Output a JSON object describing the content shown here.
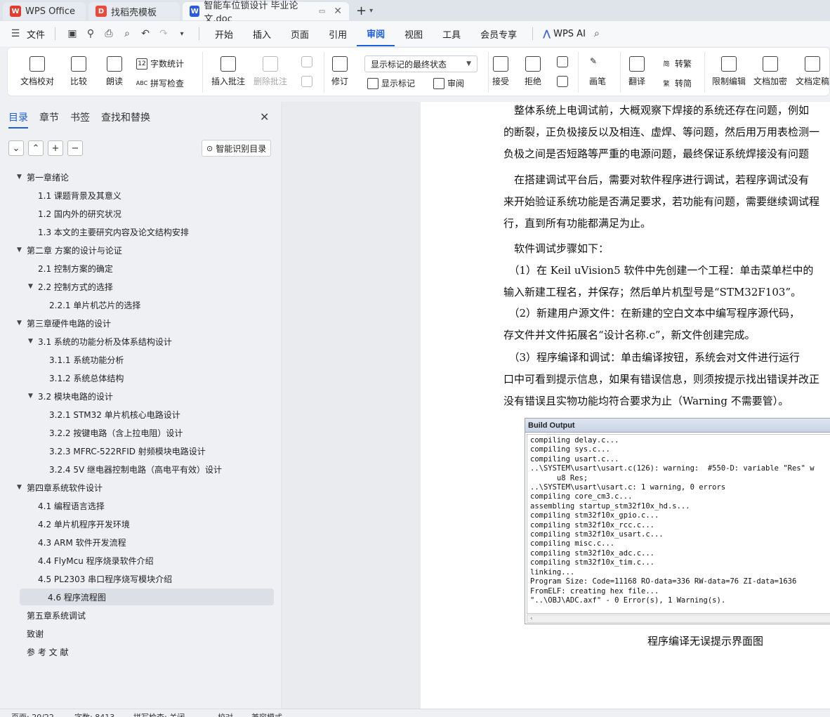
{
  "tabs": [
    {
      "label": "WPS Office",
      "logo": "W",
      "color": "#e33b2e"
    },
    {
      "label": "找稻壳模板",
      "logo": "D",
      "color": "#e84a3c"
    },
    {
      "label": "智能车位锁设计 毕业论文.doc",
      "logo": "W",
      "color": "#2b5bd7"
    }
  ],
  "menubar": {
    "file": "文件",
    "items": [
      "开始",
      "插入",
      "页面",
      "引用",
      "审阅",
      "视图",
      "工具",
      "会员专享"
    ],
    "active": "审阅",
    "wps_ai": "WPS AI"
  },
  "ribbon": {
    "doc_check": "文档校对",
    "compare": "比较",
    "read_aloud": "朗读",
    "word_count": "字数统计",
    "spell_check": "拼写检查",
    "insert_comment": "插入批注",
    "delete_comment": "删除批注",
    "revise": "修订",
    "markup_state": "显示标记的最终状态",
    "show_markup": "显示标记",
    "review": "审阅",
    "accept": "接受",
    "reject": "拒绝",
    "ink": "画笔",
    "translate": "翻译",
    "to_traditional": "转繁",
    "to_simplified": "转简",
    "restrict_edit": "限制编辑",
    "encrypt": "文档加密",
    "finalize": "文档定稿"
  },
  "panel": {
    "tabs": [
      "目录",
      "章节",
      "书签",
      "查找和替换"
    ],
    "smart_toc": "智能识别目录",
    "toc": [
      {
        "label": "第一章绪论",
        "level": 0,
        "arrow": true
      },
      {
        "label": "1.1 课题背景及其意义",
        "level": 1,
        "arrow": false
      },
      {
        "label": "1.2 国内外的研究状况",
        "level": 1,
        "arrow": false
      },
      {
        "label": "1.3 本文的主要研究内容及论文结构安排",
        "level": 1,
        "arrow": false
      },
      {
        "label": "第二章 方案的设计与论证",
        "level": 0,
        "arrow": true
      },
      {
        "label": "2.1 控制方案的确定",
        "level": 1,
        "arrow": false
      },
      {
        "label": "2.2 控制方式的选择",
        "level": 1,
        "arrow": true
      },
      {
        "label": "2.2.1 单片机芯片的选择",
        "level": 2,
        "arrow": false
      },
      {
        "label": "第三章硬件电路的设计",
        "level": 0,
        "arrow": true
      },
      {
        "label": "3.1 系统的功能分析及体系结构设计",
        "level": 1,
        "arrow": true
      },
      {
        "label": "3.1.1 系统功能分析",
        "level": 2,
        "arrow": false
      },
      {
        "label": "3.1.2 系统总体结构",
        "level": 2,
        "arrow": false
      },
      {
        "label": "3.2 模块电路的设计",
        "level": 1,
        "arrow": true
      },
      {
        "label": "3.2.1 STM32 单片机核心电路设计",
        "level": 2,
        "arrow": false
      },
      {
        "label": "3.2.2 按键电路（含上拉电阻）设计",
        "level": 2,
        "arrow": false
      },
      {
        "label": "3.2.3 MFRC-522RFID 射频模块电路设计",
        "level": 2,
        "arrow": false
      },
      {
        "label": "3.2.4 5V 继电器控制电路（高电平有效）设计",
        "level": 2,
        "arrow": false
      },
      {
        "label": "第四章系统软件设计",
        "level": 0,
        "arrow": true
      },
      {
        "label": "4.1 编程语言选择",
        "level": 1,
        "arrow": false
      },
      {
        "label": "4.2 单片机程序开发环境",
        "level": 1,
        "arrow": false
      },
      {
        "label": "4.3 ARM 软件开发流程",
        "level": 1,
        "arrow": false
      },
      {
        "label": "4.4 FlyMcu 程序烧录软件介绍",
        "level": 1,
        "arrow": false
      },
      {
        "label": "4.5 PL2303 串口程序烧写模块介绍",
        "level": 1,
        "arrow": false
      },
      {
        "label": "4.6 程序流程图",
        "level": 1,
        "arrow": false,
        "selected": true
      },
      {
        "label": "第五章系统调试",
        "level": 0,
        "arrow": false
      },
      {
        "label": "致谢",
        "level": 0,
        "arrow": false
      },
      {
        "label": "参 考 文 献",
        "level": 0,
        "arrow": false
      }
    ]
  },
  "document": {
    "lines": [
      "　整体系统上电调试前，大概观察下焊接的系统还存在问题，例如",
      "的断裂，正负极接反以及相连、虚焊、等问题，然后用万用表检测一",
      "负极之间是否短路等严重的电源问题，最终保证系统焊接没有问题",
      "　在搭建调试平台后，需要对软件程序进行调试，若程序调试没有",
      "来开始验证系统功能是否满足要求，若功能有问题，需要继续调试程",
      "行，直到所有功能都满足为止。",
      "　软件调试步骤如下：",
      "　（1）在 Keil uVision5 软件中先创建一个工程：单击菜单栏中的",
      "输入新建工程名，并保存；然后单片机型号是“STM32F103”。",
      "　（2）新建用户源文件：在新建的空白文本中编写程序源代码，",
      "存文件并文件拓展名“设计名称.c”，新文件创建完成。",
      "　（3）程序编译和调试：单击编译按钮，系统会对文件进行运行",
      "口中可看到提示信息，如果有错误信息，则须按提示找出错误并改正",
      "没有错误且实物功能均符合要求为止（Warning 不需要管）。"
    ],
    "build_title": "Build Output",
    "build_lines": [
      "compiling delay.c...",
      "compiling sys.c...",
      "compiling usart.c...",
      "..\\SYSTEM\\usart\\usart.c(126): warning:  #550-D: variable \"Res\" w",
      "      u8 Res;",
      "..\\SYSTEM\\usart\\usart.c: 1 warning, 0 errors",
      "compiling core_cm3.c...",
      "assembling startup_stm32f10x_hd.s...",
      "compiling stm32f10x_gpio.c...",
      "compiling stm32f10x_rcc.c...",
      "compiling stm32f10x_usart.c...",
      "compiling misc.c...",
      "compiling stm32f10x_adc.c...",
      "compiling stm32f10x_tim.c...",
      "linking...",
      "Program Size: Code=11168 RO-data=336 RW-data=76 ZI-data=1636",
      "FromELF: creating hex file...",
      "\"..\\OBJ\\ADC.axf\" - 0 Error(s), 1 Warning(s)."
    ],
    "caption": "程序编译无误提示界面图"
  },
  "status": {
    "page": "页面: 20/22",
    "words": "字数: 8413",
    "spell": "拼写检查: 关闭",
    "proof": "校对",
    "compat": "兼容模式"
  }
}
